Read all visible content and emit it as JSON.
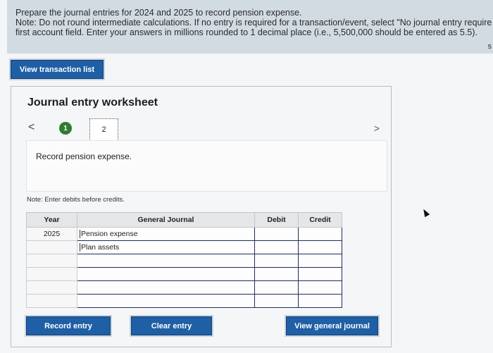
{
  "instructions": {
    "line1": "Prepare the journal entries for 2024 and 2025 to record pension expense.",
    "line2": "Note: Do not round intermediate calculations. If no entry is required for a transaction/event, select \"No journal entry require",
    "line3": "first account field. Enter your answers in millions rounded to 1 decimal place (i.e., 5,500,000 should be entered as 5.5).",
    "edge_mark": "s"
  },
  "buttons": {
    "view_transaction_list": "View transaction list",
    "record_entry": "Record entry",
    "clear_entry": "Clear entry",
    "view_general_journal": "View general journal"
  },
  "worksheet": {
    "title": "Journal entry worksheet",
    "prev_glyph": "<",
    "next_glyph": ">",
    "steps": [
      "1",
      "2"
    ],
    "description": "Record pension expense.",
    "note": "Note: Enter debits before credits."
  },
  "journal": {
    "headers": {
      "year": "Year",
      "account": "General Journal",
      "debit": "Debit",
      "credit": "Credit"
    },
    "rows": [
      {
        "year": "2025",
        "account": "Pension expense",
        "debit": "",
        "credit": ""
      },
      {
        "year": "",
        "account": "Plan assets",
        "debit": "",
        "credit": ""
      },
      {
        "year": "",
        "account": "",
        "debit": "",
        "credit": ""
      },
      {
        "year": "",
        "account": "",
        "debit": "",
        "credit": ""
      },
      {
        "year": "",
        "account": "",
        "debit": "",
        "credit": ""
      },
      {
        "year": "",
        "account": "",
        "debit": "",
        "credit": ""
      }
    ]
  },
  "colors": {
    "button_blue": "#1f5fa6",
    "instruction_bg": "#d2dbe2",
    "step_complete_green": "#2f7d32"
  }
}
